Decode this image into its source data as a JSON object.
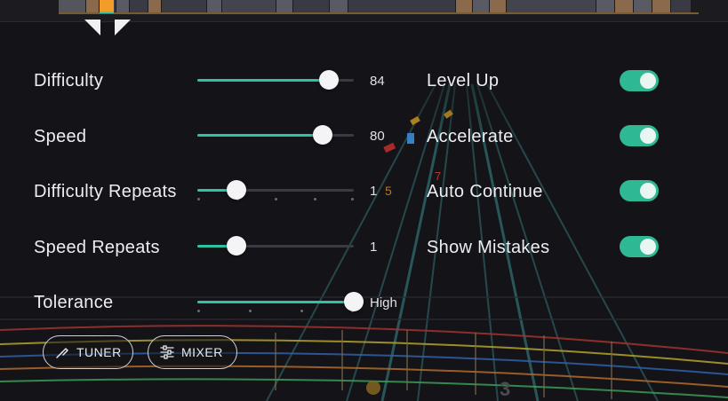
{
  "settings": {
    "difficulty": {
      "label": "Difficulty",
      "value": "84",
      "level": 0.84
    },
    "speed": {
      "label": "Speed",
      "value": "80",
      "level": 0.8
    },
    "difficulty_repeats": {
      "label": "Difficulty Repeats",
      "value": "1",
      "level": 0.25
    },
    "speed_repeats": {
      "label": "Speed Repeats",
      "value": "1",
      "level": 0.25
    },
    "tolerance": {
      "label": "Tolerance",
      "value": "High",
      "level": 1.0
    }
  },
  "toggles": [
    {
      "label": "Level Up",
      "on": true
    },
    {
      "label": "Accelerate",
      "on": true
    },
    {
      "label": "Auto Continue",
      "on": true
    },
    {
      "label": "Show Mistakes",
      "on": true
    }
  ],
  "buttons": {
    "tuner": "TUNER",
    "mixer": "MIXER"
  },
  "background": {
    "string_numbers": [
      "5",
      "7",
      "3"
    ]
  },
  "colors": {
    "accent": "#2ec4a3",
    "toggle_on": "#2eb894",
    "marker": "#f39c2a"
  },
  "icons": {
    "tuner": "tuning-fork-icon",
    "mixer": "sliders-icon"
  }
}
